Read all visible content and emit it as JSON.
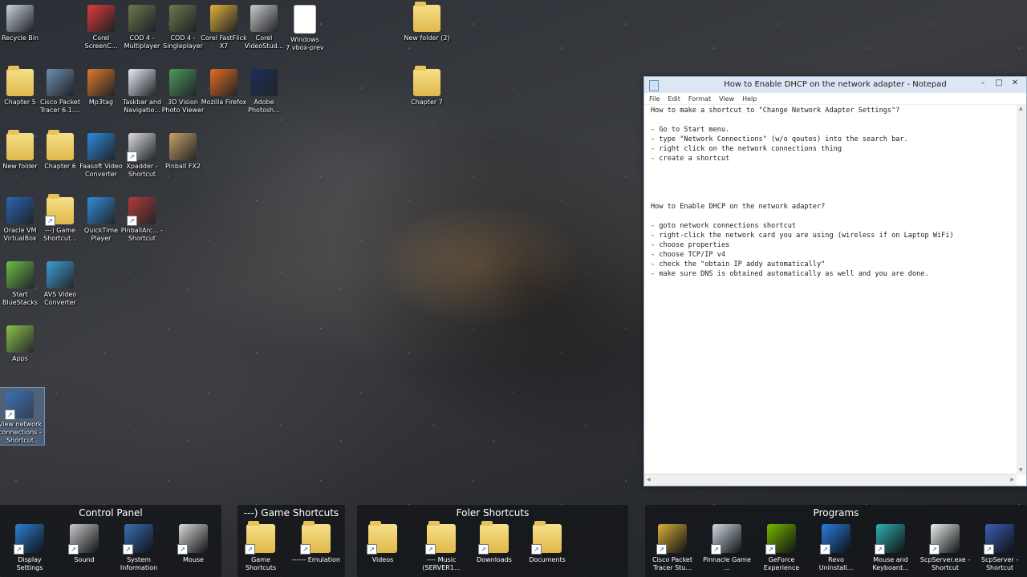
{
  "desktop_icons": [
    {
      "label": "Recycle Bin",
      "icon": "recycle-bin-icon",
      "color": "#c9d3dd"
    },
    {
      "label": "Corel ScreenC...",
      "icon": "record-icon",
      "color": "#e23b3b"
    },
    {
      "label": "COD 4 - Multiplayer",
      "icon": "game-icon",
      "color": "#6b7a4e"
    },
    {
      "label": "COD 4 - Singleplayer",
      "icon": "game-icon",
      "color": "#6b7a4e"
    },
    {
      "label": "Corel FastFlick X7",
      "icon": "star-icon",
      "color": "#e3b23c"
    },
    {
      "label": "Corel VideoStud...",
      "icon": "video-icon",
      "color": "#cccccc"
    },
    {
      "label": "Windows 7.vbox-prev",
      "icon": "file-icon",
      "color": "#ffffff"
    },
    {
      "label": "New folder (2)",
      "icon": "folder-icon",
      "color": "#e8c35a"
    },
    {
      "label": "Chapter 5",
      "icon": "folder-icon",
      "color": "#e8c35a"
    },
    {
      "label": "Cisco Packet Tracer 6.1....",
      "icon": "network-icon",
      "color": "#6e8fb0"
    },
    {
      "label": "Mp3tag",
      "icon": "check-icon",
      "color": "#e07b2a"
    },
    {
      "label": "Taskbar and Navigatio...",
      "icon": "document-icon",
      "color": "#e8eef6"
    },
    {
      "label": "3D Vision Photo Viewer",
      "icon": "photo-icon",
      "color": "#4e9a5c"
    },
    {
      "label": "Mozilla Firefox",
      "icon": "firefox-icon",
      "color": "#e66b1f"
    },
    {
      "label": "Adobe Photosh...",
      "icon": "photoshop-icon",
      "color": "#1c2f5a"
    },
    {
      "label": "Chapter 7",
      "icon": "folder-icon",
      "color": "#e8c35a"
    },
    {
      "label": "New folder",
      "icon": "folder-icon",
      "color": "#e8c35a"
    },
    {
      "label": "Chapter 6",
      "icon": "folder-icon",
      "color": "#e8c35a"
    },
    {
      "label": "Faasoft Video Converter",
      "icon": "film-icon",
      "color": "#2b8be0"
    },
    {
      "label": "Xpadder - Shortcut",
      "icon": "gamepad-icon",
      "color": "#dddddd"
    },
    {
      "label": "Pinball FX2",
      "icon": "pinball-icon",
      "color": "#c8a066"
    },
    {
      "label": "Oracle VM VirtualBox",
      "icon": "virtualbox-icon",
      "color": "#2a65b5"
    },
    {
      "label": "---) Game Shortcut...",
      "icon": "folder-icon",
      "color": "#e8c35a"
    },
    {
      "label": "QuickTime Player",
      "icon": "quicktime-icon",
      "color": "#2f8ee0"
    },
    {
      "label": "PinballArc... - Shortcut",
      "icon": "pinball-icon",
      "color": "#b33b3b"
    },
    {
      "label": "Start BlueStacks",
      "icon": "bluestacks-icon",
      "color": "#6cbd45"
    },
    {
      "label": "AVS Video Converter",
      "icon": "avs-icon",
      "color": "#3aa0d8"
    },
    {
      "label": "Apps",
      "icon": "apps-icon",
      "color": "#8cc34a"
    },
    {
      "label": "View network connections - Shortcut",
      "icon": "network-connections-icon",
      "color": "#3a6fb8"
    }
  ],
  "notepad": {
    "title": "How to Enable DHCP on the network adapter - Notepad",
    "menu": [
      "File",
      "Edit",
      "Format",
      "View",
      "Help"
    ],
    "content": "How to make a shortcut to \"Change Network Adapter Settings\"?\n\n- Go to Start menu.\n- type \"Network Connections\" (w/o qoutes) into the search bar.\n- right click on the network connections thing\n- create a shortcut\n\n\n\n\nHow to Enable DHCP on the network adapter?\n\n- goto network connections shortcut\n- right-click the network card you are using (wireless if on Laptop WiFi)\n- choose properties\n- choose TCP/IP v4\n- check the \"obtain IP addy automatically\"\n- make sure DNS is obtained automatically as well and you are done."
  },
  "groups": [
    {
      "title": "Control Panel",
      "items": [
        {
          "label": "Display Settings",
          "icon": "display-icon",
          "color": "#2d7fd3"
        },
        {
          "label": "Sound",
          "icon": "speaker-icon",
          "color": "#c9c9c9"
        },
        {
          "label": "System Information",
          "icon": "system-info-icon",
          "color": "#3b6fb5"
        },
        {
          "label": "Mouse",
          "icon": "mouse-icon",
          "color": "#d9d9d9"
        }
      ]
    },
    {
      "title": "---) Game Shortcuts",
      "items": [
        {
          "label": "Game Shortcuts",
          "icon": "folder-icon",
          "color": "#e8c35a"
        },
        {
          "label": "------ Emulation",
          "icon": "folder-icon",
          "color": "#e8c35a"
        }
      ]
    },
    {
      "title": "Foler Shortcuts",
      "items": [
        {
          "label": "Videos",
          "icon": "videos-folder-icon",
          "color": "#e8c35a"
        },
        {
          "label": "---- Music (SERVER1...",
          "icon": "music-folder-icon",
          "color": "#e8c35a"
        },
        {
          "label": "Downloads",
          "icon": "downloads-folder-icon",
          "color": "#e8c35a"
        },
        {
          "label": "Documents",
          "icon": "documents-folder-icon",
          "color": "#e8c35a"
        }
      ]
    },
    {
      "title": "Programs",
      "items": [
        {
          "label": "Cisco Packet Tracer Stu...",
          "icon": "cisco-icon",
          "color": "#d8b03a"
        },
        {
          "label": "Pinnacle Game ...",
          "icon": "pinnacle-icon",
          "color": "#cfd8e3"
        },
        {
          "label": "GeForce Experience",
          "icon": "nvidia-icon",
          "color": "#76b900"
        },
        {
          "label": "Revo Uninstall...",
          "icon": "revo-icon",
          "color": "#2a7de0"
        },
        {
          "label": "Mouse and Keyboard...",
          "icon": "keyboard-icon",
          "color": "#2fb0b0"
        },
        {
          "label": "ScpServer.exe - Shortcut",
          "icon": "app-window-icon",
          "color": "#e8f0e8"
        },
        {
          "label": "ScpServer - Shortcut",
          "icon": "shield-icon",
          "color": "#3b5fb5"
        }
      ]
    }
  ]
}
